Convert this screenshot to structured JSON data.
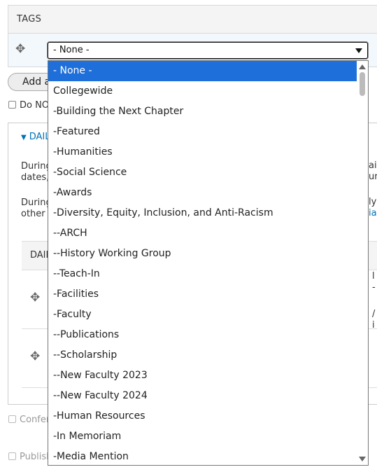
{
  "tags": {
    "title": "TAGS",
    "select_value": "- None -",
    "add_button": "Add a"
  },
  "checkbox_do_not": "Do NO",
  "daily": {
    "summary": "DAIL",
    "desc1_line1": "During",
    "desc1_line2": "dates,",
    "desc2_line1": "During",
    "desc2_line2": "other",
    "right_frag_1a": "ail",
    "right_frag_1b": "ur",
    "right_frag_2a": "ly",
    "right_frag_2b": "ia",
    "table_header": "DAIL",
    "row1_frag_a": "l",
    "row1_frag_b": "-",
    "row2_frag_a": "/",
    "row2_frag_b": "i"
  },
  "checkbox_confer": "Confer",
  "checkbox_publish": "Publisl",
  "dropdown": {
    "options": [
      "- None -",
      "Collegewide",
      "-Building the Next Chapter",
      "-Featured",
      "-Humanities",
      "-Social Science",
      "-Awards",
      "-Diversity, Equity, Inclusion, and Anti-Racism",
      "--ARCH",
      "--History Working Group",
      "--Teach-In",
      "-Facilities",
      "-Faculty",
      "--Publications",
      "--Scholarship",
      "--New Faculty 2023",
      "--New Faculty 2024",
      "-Human Resources",
      "-In Memoriam",
      "-Media Mention"
    ],
    "selected_index": 0
  },
  "colors": {
    "selected_bg": "#1e6fd9",
    "link": "#0071b8"
  },
  "icons": {
    "drag": "move-cross-icon",
    "dropdown_arrow": "caret-down-icon"
  }
}
